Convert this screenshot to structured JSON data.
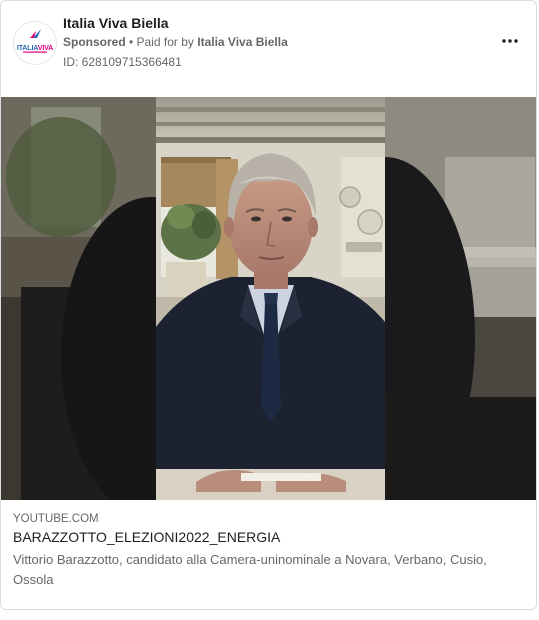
{
  "ad": {
    "page_name": "Italia Viva Biella",
    "sponsored_label": "Sponsored",
    "separator": " • ",
    "paid_for_prefix": "Paid for by ",
    "paid_for_name": "Italia Viva Biella",
    "ad_id_text": "ID: 628109715366481",
    "avatar_logo_text": "ITALIAVIVA",
    "more_icon": "more-horizontal-icon"
  },
  "media": {
    "type": "video-thumbnail"
  },
  "link": {
    "domain": "YOUTUBE.COM",
    "headline": "BARAZZOTTO_ELEZIONI2022_ENERGIA",
    "description": "Vittorio Barazzotto, candidato alla Camera-uninominale a Novara, Verbano, Cusio, Ossola"
  },
  "colors": {
    "brand_magenta": "#e6007e",
    "brand_blue": "#2d6ab4",
    "text_primary": "#1c1e21",
    "text_secondary": "#65676b",
    "border": "#dadde1"
  }
}
